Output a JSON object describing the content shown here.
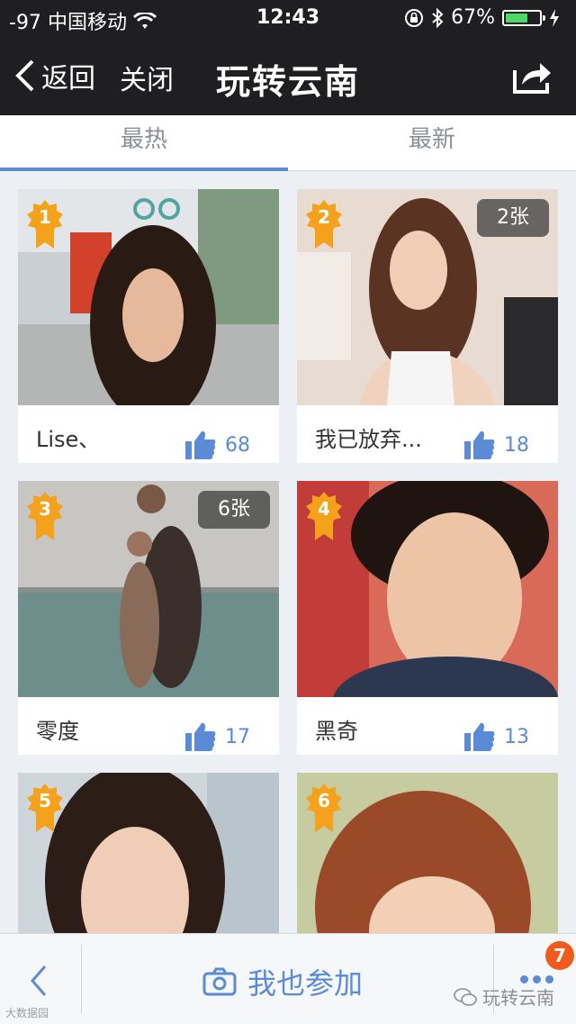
{
  "status_bar": {
    "signal": "-97",
    "carrier": "中国移动",
    "time": "12:43",
    "battery_percent": "67%",
    "battery_level": 0.67,
    "icons": [
      "wifi-icon",
      "lock-rotation-icon",
      "bluetooth-icon",
      "battery-icon",
      "charging-icon"
    ]
  },
  "nav": {
    "back_label": "返回",
    "close_label": "关闭",
    "title": "玩转云南",
    "share_icon": "share-icon"
  },
  "tabs": [
    {
      "label": "最热",
      "active": true
    },
    {
      "label": "最新",
      "active": false
    }
  ],
  "cards": [
    {
      "rank": "1",
      "name": "Lise、",
      "likes": "68",
      "photo_count": null
    },
    {
      "rank": "2",
      "name": "我已放弃...",
      "likes": "18",
      "photo_count": "2张"
    },
    {
      "rank": "3",
      "name": "零度",
      "likes": "17",
      "photo_count": "6张"
    },
    {
      "rank": "4",
      "name": "黑奇",
      "likes": "13",
      "photo_count": null
    },
    {
      "rank": "5",
      "name": "",
      "likes": "",
      "photo_count": null
    },
    {
      "rank": "6",
      "name": "",
      "likes": "",
      "photo_count": null
    }
  ],
  "bottom_bar": {
    "join_label": "我也参加",
    "notification_count": "7",
    "watermark": "玩转云南",
    "watermark_small": "大数据园"
  },
  "colors": {
    "accent": "#5b8bd6",
    "nav_bg": "#1f1f21",
    "rank_badge": "#f4a11c",
    "notification": "#f05a1a"
  }
}
